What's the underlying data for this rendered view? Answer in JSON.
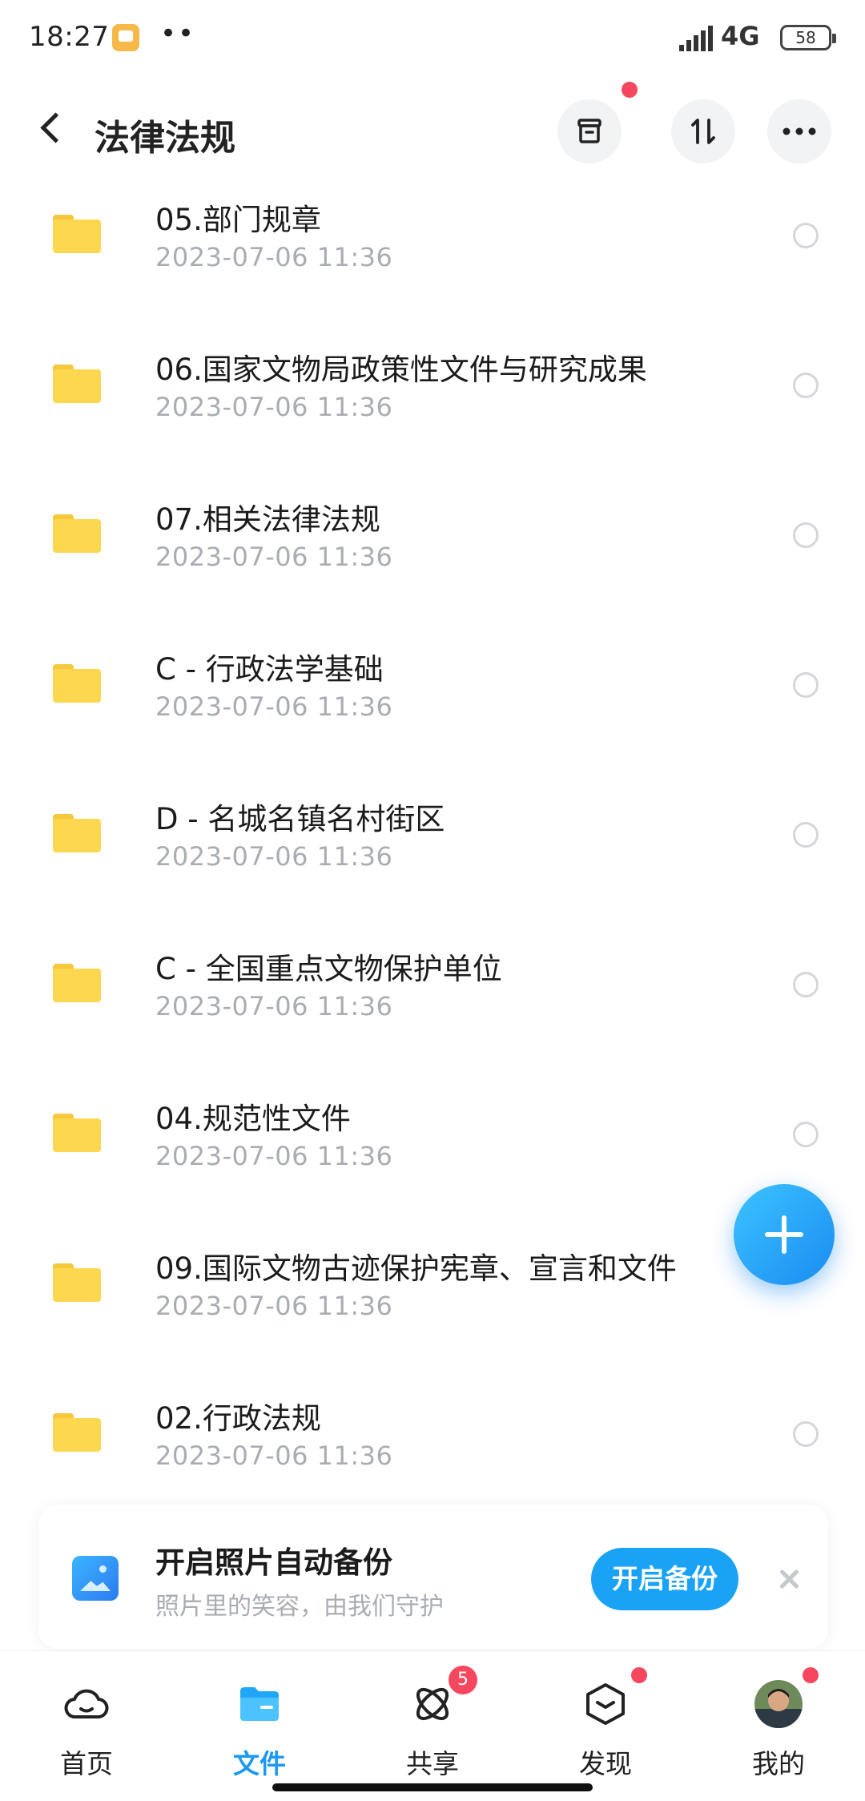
{
  "status_bar": {
    "time": "18:27",
    "dots": "••",
    "network": "4G",
    "battery": "58"
  },
  "header": {
    "title": "法律法规"
  },
  "files": [
    {
      "name": "05.部门规章",
      "time": "2023-07-06  11:36"
    },
    {
      "name": "06.国家文物局政策性文件与研究成果",
      "time": "2023-07-06  11:36"
    },
    {
      "name": "07.相关法律法规",
      "time": "2023-07-06  11:36"
    },
    {
      "name": "C - 行政法学基础",
      "time": "2023-07-06  11:36"
    },
    {
      "name": "D - 名城名镇名村街区",
      "time": "2023-07-06  11:36"
    },
    {
      "name": "C - 全国重点文物保护单位",
      "time": "2023-07-06  11:36"
    },
    {
      "name": "04.规范性文件",
      "time": "2023-07-06  11:36"
    },
    {
      "name": "09.国际文物古迹保护宪章、宣言和文件",
      "time": "2023-07-06  11:36"
    },
    {
      "name": "02.行政法规",
      "time": "2023-07-06  11:36"
    }
  ],
  "backup_banner": {
    "title": "开启照片自动备份",
    "subtitle": "照片里的笑容，由我们守护",
    "button": "开启备份"
  },
  "bottom_nav": {
    "items": [
      {
        "label": "首页",
        "icon": "cloud-icon"
      },
      {
        "label": "文件",
        "icon": "folder-icon",
        "active": true
      },
      {
        "label": "共享",
        "icon": "share-orbit-icon",
        "badge": "5"
      },
      {
        "label": "发现",
        "icon": "discover-box-icon"
      },
      {
        "label": "我的",
        "icon": "avatar"
      }
    ]
  },
  "colors": {
    "accent": "#1a9af2",
    "folder": "#fcd74f",
    "badge": "#f5475e",
    "muted_text": "#a9adb3"
  }
}
